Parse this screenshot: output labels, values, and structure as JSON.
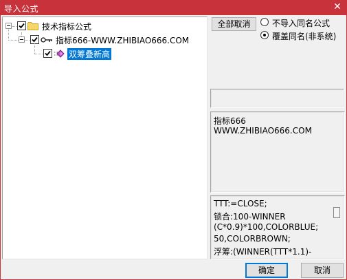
{
  "window": {
    "title": "导入公式",
    "close_glyph": "✕"
  },
  "tree": {
    "root": {
      "label": "技术指标公式",
      "checked": true,
      "icon": "folder-icon"
    },
    "group": {
      "label": "指标666-WWW.ZHIBIAO666.COM",
      "checked": true,
      "icon": "key-icon"
    },
    "leaf": {
      "label": "双筹叠新高",
      "checked": true,
      "selected": true,
      "icon": "formula-icon"
    }
  },
  "actions": {
    "cancel_all_label": "全部取消",
    "ok_label": "确定",
    "cancel_label": "取消"
  },
  "options": {
    "skip_same_name": {
      "label": "不导入同名公式",
      "selected": false
    },
    "overwrite_same_name": {
      "label": "覆盖同名(非系统)",
      "selected": true
    }
  },
  "description": {
    "lines": [
      "指标666",
      "WWW.ZHIBIAO666.COM"
    ]
  },
  "code": {
    "lines": [
      "TTT:=CLOSE;",
      "锁合:100-WINNER",
      "(C*0.9)*100,COLORBLUE;",
      "50,COLORBROWN;",
      "浮筹:(WINNER(TTT*1.1)-"
    ]
  },
  "colors": {
    "titlebar": "#c8323a",
    "selection": "#0078d7"
  }
}
